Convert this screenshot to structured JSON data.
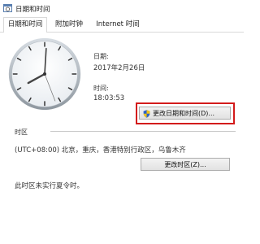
{
  "window": {
    "title": "日期和时间"
  },
  "tabs": [
    {
      "label": "日期和时间",
      "active": true
    },
    {
      "label": "附加时钟",
      "active": false
    },
    {
      "label": "Internet 时间",
      "active": false
    }
  ],
  "datetime": {
    "date_label": "日期:",
    "date_value": "2017年2月26日",
    "time_label": "时间:",
    "time_value": "18:03:53",
    "change_datetime_button": "更改日期和时间(D)..."
  },
  "timezone": {
    "section_label": "时区",
    "value": "(UTC+08:00) 北京，重庆，香港特别行政区，乌鲁木齐",
    "change_timezone_button": "更改时区(Z)...",
    "dst_note": "此时区未实行夏令时。"
  },
  "colors": {
    "highlight": "#d31b1b",
    "button_bg": "#e8e8e8"
  }
}
